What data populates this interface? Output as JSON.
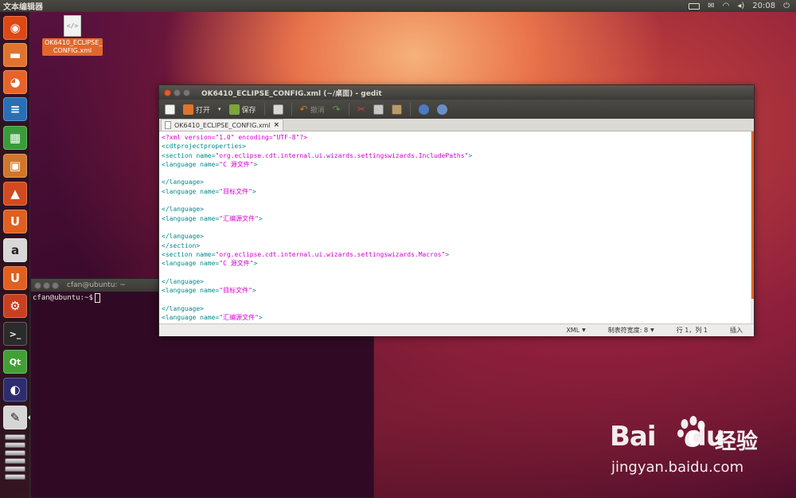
{
  "top_panel": {
    "app_title": "文本编辑器",
    "clock": "20:08",
    "indicators": [
      "keyboard-icon",
      "mail-icon",
      "network-icon",
      "volume-icon",
      "power-icon"
    ]
  },
  "launcher": {
    "items": [
      {
        "name": "ubuntu-dash-icon",
        "color": "#dd4814",
        "glyph": "◉"
      },
      {
        "name": "files-icon",
        "color": "#e0742e",
        "glyph": "▬"
      },
      {
        "name": "firefox-icon",
        "color": "#e8632a",
        "glyph": "◕"
      },
      {
        "name": "writer-icon",
        "color": "#2a6fb5",
        "glyph": "≡"
      },
      {
        "name": "calc-icon",
        "color": "#3a9b3a",
        "glyph": "▦"
      },
      {
        "name": "impress-icon",
        "color": "#d0762a",
        "glyph": "▣"
      },
      {
        "name": "software-center-icon",
        "color": "#d24a1f",
        "glyph": "▲"
      },
      {
        "name": "ubuntu-one-icon",
        "color": "#e06020",
        "glyph": "U"
      },
      {
        "name": "amazon-icon",
        "color": "#d8d8d8",
        "glyph": "a"
      },
      {
        "name": "ubuntu-one-music-icon",
        "color": "#e06020",
        "glyph": "U"
      },
      {
        "name": "system-settings-icon",
        "color": "#c84020",
        "glyph": "⚙"
      },
      {
        "name": "terminal-icon",
        "color": "#2b2b2b",
        "glyph": ">_"
      },
      {
        "name": "qt-creator-icon",
        "color": "#41a035",
        "glyph": "Qt"
      },
      {
        "name": "eclipse-icon",
        "color": "#2c2c6e",
        "glyph": "◐"
      },
      {
        "name": "gedit-icon",
        "color": "#d6d6d6",
        "glyph": "✎"
      }
    ],
    "stack_count": 6
  },
  "desktop": {
    "file_label": "OK6410_ECLIPSE_\nCONFIG.xml",
    "file_glyph": "</>"
  },
  "terminal": {
    "title": "cfan@ubuntu: ~",
    "prompt": "cfan@ubuntu:~$"
  },
  "gedit": {
    "title": "OK6410_ECLIPSE_CONFIG.xml (~/桌面) - gedit",
    "toolbar": {
      "open_label": "打开",
      "save_label": "保存",
      "undo_label": "撤消"
    },
    "tab_label": "OK6410_ECLIPSE_CONFIG.xml",
    "tab_close": "×",
    "code": [
      {
        "type": "pi",
        "text": "<?xml version=\"1.0\" encoding=\"UTF-8\"?>"
      },
      {
        "type": "tag",
        "text": "<cdtprojectproperties>"
      },
      {
        "type": "el",
        "tag_open": "<section name=",
        "value": "\"org.eclipse.cdt.internal.ui.wizards.settingswizards.IncludePaths\"",
        "tag_close": ">"
      },
      {
        "type": "el",
        "tag_open": "<language name=",
        "value": "\"C 源文件\"",
        "tag_close": ">"
      },
      {
        "type": "blank",
        "text": ""
      },
      {
        "type": "tag",
        "text": "</language>"
      },
      {
        "type": "el",
        "tag_open": "<language name=",
        "value": "\"目标文件\"",
        "tag_close": ">"
      },
      {
        "type": "blank",
        "text": ""
      },
      {
        "type": "tag",
        "text": "</language>"
      },
      {
        "type": "el",
        "tag_open": "<language name=",
        "value": "\"汇编源文件\"",
        "tag_close": ">"
      },
      {
        "type": "blank",
        "text": ""
      },
      {
        "type": "tag",
        "text": "</language>"
      },
      {
        "type": "tag",
        "text": "</section>"
      },
      {
        "type": "el",
        "tag_open": "<section name=",
        "value": "\"org.eclipse.cdt.internal.ui.wizards.settingswizards.Macros\"",
        "tag_close": ">"
      },
      {
        "type": "el",
        "tag_open": "<language name=",
        "value": "\"C 源文件\"",
        "tag_close": ">"
      },
      {
        "type": "blank",
        "text": ""
      },
      {
        "type": "tag",
        "text": "</language>"
      },
      {
        "type": "el",
        "tag_open": "<language name=",
        "value": "\"目标文件\"",
        "tag_close": ">"
      },
      {
        "type": "blank",
        "text": ""
      },
      {
        "type": "tag",
        "text": "</language>"
      },
      {
        "type": "el",
        "tag_open": "<language name=",
        "value": "\"汇编源文件\"",
        "tag_close": ">"
      }
    ],
    "status": {
      "language": "XML",
      "tab_width": "制表符宽度: 8",
      "position": "行 1，列 1",
      "mode": "插入"
    },
    "colors": {
      "tag": "#008b8b",
      "value": "#d000d0",
      "accent": "#e2672b"
    }
  },
  "watermark": {
    "logo": "Bai",
    "logo_suffix": "du",
    "cn": "经验",
    "url": "jingyan.baidu.com"
  }
}
